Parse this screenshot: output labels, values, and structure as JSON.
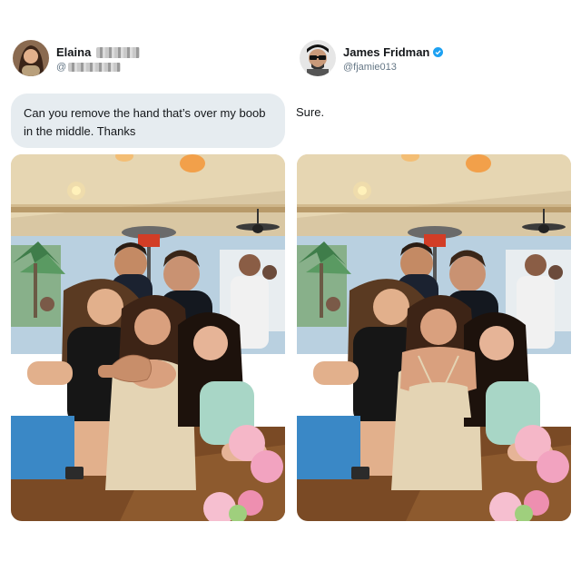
{
  "left_tweet": {
    "display_name": "Elaina",
    "handle": "@",
    "message": "Can you remove the hand that’s over my boob in the middle. Thanks",
    "avatar_icon": "user-avatar-woman"
  },
  "right_tweet": {
    "display_name": "James Fridman",
    "handle": "@fjamie013",
    "message": "Sure.",
    "verified": true,
    "verified_color": "#1da1f2",
    "avatar_icon": "user-avatar-man-sunglasses"
  },
  "colors": {
    "bubble": "#e6ecf0",
    "text": "#14171a",
    "secondary_text": "#657786"
  }
}
